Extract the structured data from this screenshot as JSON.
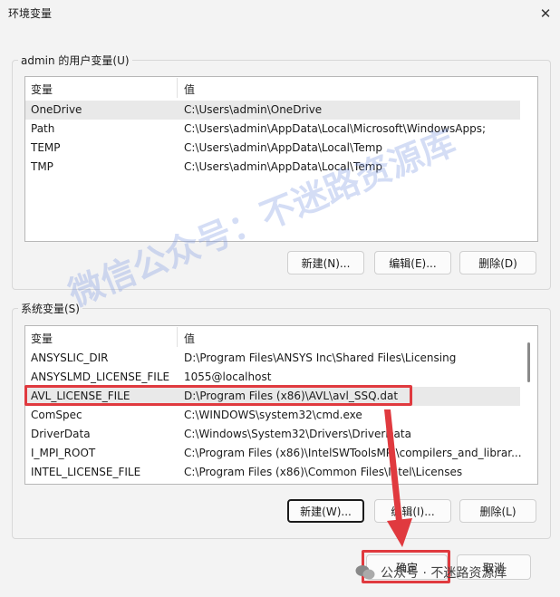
{
  "window": {
    "title": "环境变量",
    "close_glyph": "✕"
  },
  "user_vars": {
    "label": "admin 的用户变量(U)",
    "headers": [
      "变量",
      "值"
    ],
    "rows": [
      {
        "name": "OneDrive",
        "value": "C:\\Users\\admin\\OneDrive"
      },
      {
        "name": "Path",
        "value": "C:\\Users\\admin\\AppData\\Local\\Microsoft\\WindowsApps;"
      },
      {
        "name": "TEMP",
        "value": "C:\\Users\\admin\\AppData\\Local\\Temp"
      },
      {
        "name": "TMP",
        "value": "C:\\Users\\admin\\AppData\\Local\\Temp"
      }
    ],
    "buttons": {
      "new": "新建(N)...",
      "edit": "编辑(E)...",
      "delete": "删除(D)"
    }
  },
  "system_vars": {
    "label": "系统变量(S)",
    "headers": [
      "变量",
      "值"
    ],
    "rows": [
      {
        "name": "ANSYSLIC_DIR",
        "value": "D:\\Program Files\\ANSYS Inc\\Shared Files\\Licensing"
      },
      {
        "name": "ANSYSLMD_LICENSE_FILE",
        "value": "1055@localhost"
      },
      {
        "name": "AVL_LICENSE_FILE",
        "value": "D:\\Program Files (x86)\\AVL\\avl_SSQ.dat"
      },
      {
        "name": "ComSpec",
        "value": "C:\\WINDOWS\\system32\\cmd.exe"
      },
      {
        "name": "DriverData",
        "value": "C:\\Windows\\System32\\Drivers\\DriverData"
      },
      {
        "name": "I_MPI_ROOT",
        "value": "C:\\Program Files (x86)\\IntelSWToolsMPI\\compilers_and_librar..."
      },
      {
        "name": "INTEL_LICENSE_FILE",
        "value": "C:\\Program Files (x86)\\Common Files\\Intel\\Licenses"
      }
    ],
    "buttons": {
      "new": "新建(W)...",
      "edit": "编辑(I)...",
      "delete": "删除(L)"
    }
  },
  "dialog_buttons": {
    "ok": "确定",
    "cancel": "取消"
  },
  "watermark": "微信公众号：不迷路资源库",
  "footer": {
    "text": "公众号 · 不迷路资源库",
    "icon": "wechat-icon"
  },
  "colors": {
    "highlight": "#e03a3f",
    "selected_row": "#e9e9e9",
    "window_bg": "#f3f3f3"
  }
}
